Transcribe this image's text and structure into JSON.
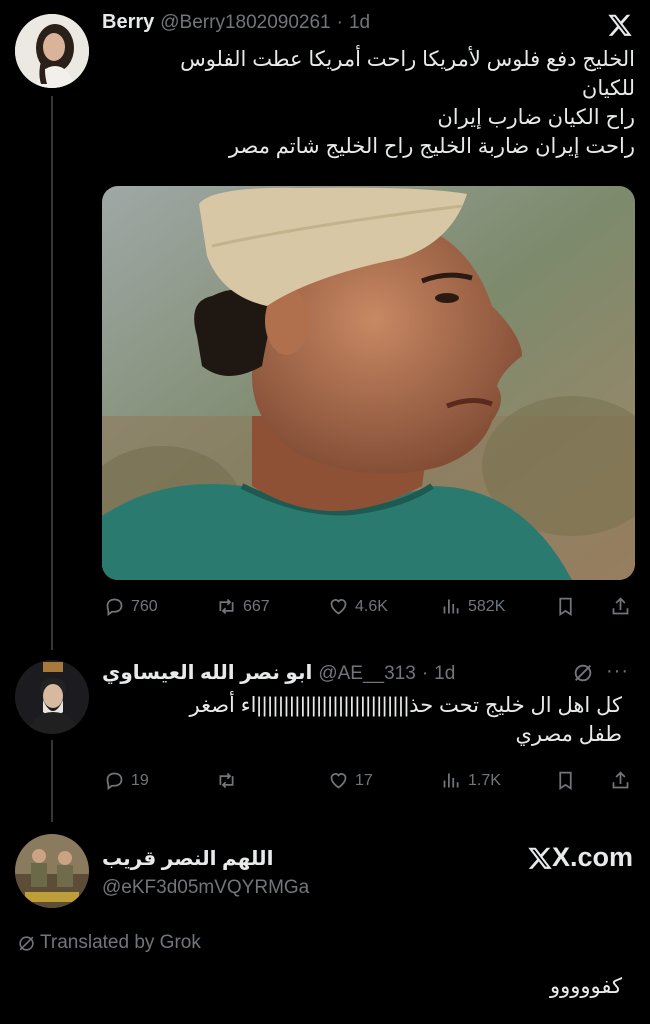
{
  "tweet": {
    "name": "Berry",
    "handle": "@Berry1802090261",
    "time": "1d",
    "lines": [
      "الخليج دفع فلوس لأمريكا راحت أمريكا عطت  الفلوس",
      "للكيان",
      "راح الكيان ضارب إيران",
      "راحت إيران ضاربة الخليج راح الخليج شاتم مصر"
    ],
    "stats": {
      "replies": "760",
      "reposts": "667",
      "likes": "4.6K",
      "views": "582K"
    },
    "icons": {
      "brand": "x-logo-icon",
      "media": "man-photo"
    }
  },
  "reply": {
    "name": "ابو نصر الله العيساوي",
    "handle": "@AE__313",
    "time": "1d",
    "lines": [
      "كل اهل ال خليج تحت حذ||||||||||||||||||||||||||||اء أصغر",
      "طفل مصري"
    ],
    "stats": {
      "replies": "19",
      "reposts": "",
      "likes": "17",
      "views": "1.7K"
    }
  },
  "card": {
    "name": "اللهم النصر قريب",
    "handle": "@eKF3d05mVQYRMGa",
    "brand": "X.com",
    "translated": "Translated by Grok",
    "text": "كفووووو"
  },
  "colors": {
    "background": "#000000",
    "text": "#e7e9ea",
    "muted": "#71767b"
  }
}
